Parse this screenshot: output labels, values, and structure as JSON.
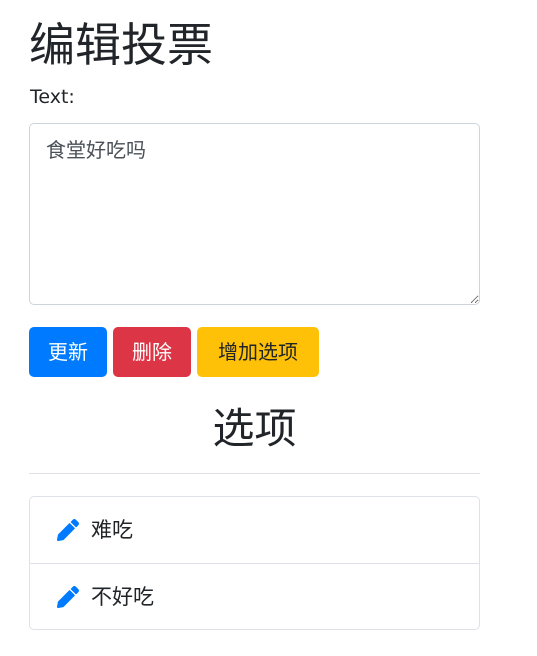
{
  "page": {
    "title": "编辑投票"
  },
  "form": {
    "text_label": "Text:",
    "text_value": "食堂好吃吗"
  },
  "buttons": {
    "update_label": "更新",
    "delete_label": "删除",
    "add_option_label": "增加选项"
  },
  "options_section": {
    "title": "选项",
    "items": [
      {
        "label": "难吃",
        "icon": "pencil-icon"
      },
      {
        "label": "不好吃",
        "icon": "pencil-icon"
      }
    ]
  },
  "colors": {
    "primary": "#007bff",
    "danger": "#dc3545",
    "warning": "#ffc107",
    "icon": "#007bff"
  }
}
